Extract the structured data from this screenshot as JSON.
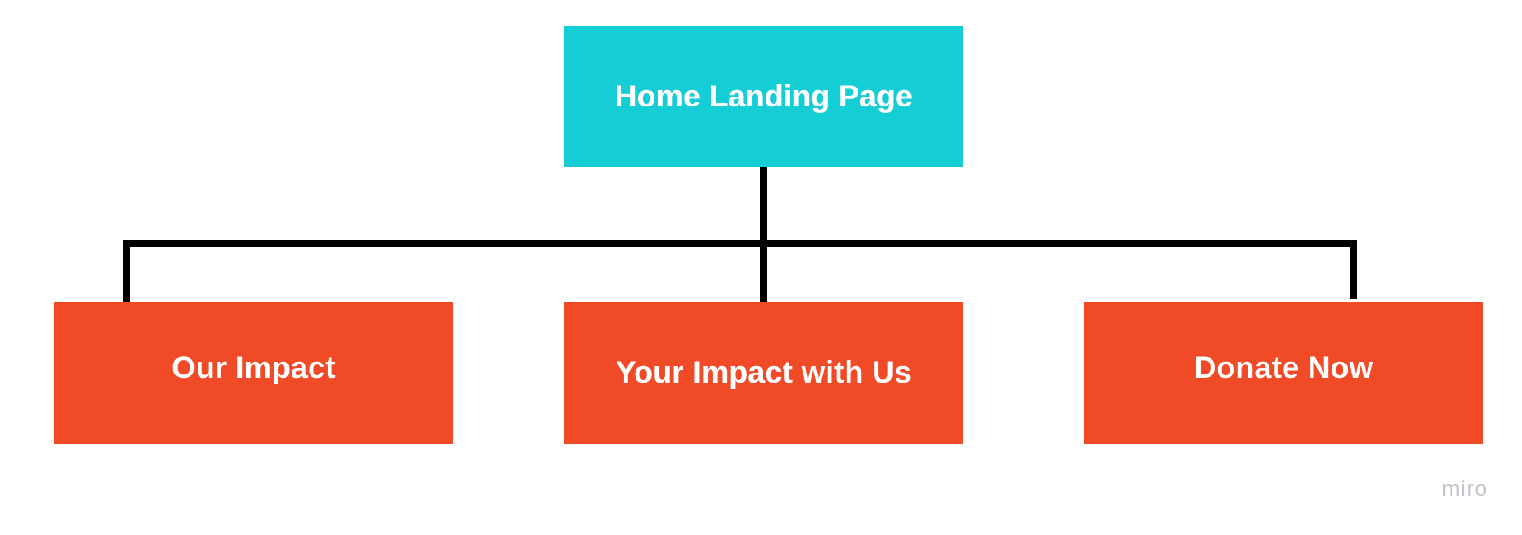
{
  "diagram": {
    "root": {
      "label": "Home Landing Page",
      "color": "#15cdd4"
    },
    "children": [
      {
        "label": "Our Impact",
        "color": "#f04a27"
      },
      {
        "label": "Your Impact with Us",
        "color": "#f04a27"
      },
      {
        "label": "Donate Now",
        "color": "#f04a27"
      }
    ],
    "connector_color": "#000000"
  },
  "watermark": {
    "text": "miro",
    "color": "#c3c5cc"
  }
}
